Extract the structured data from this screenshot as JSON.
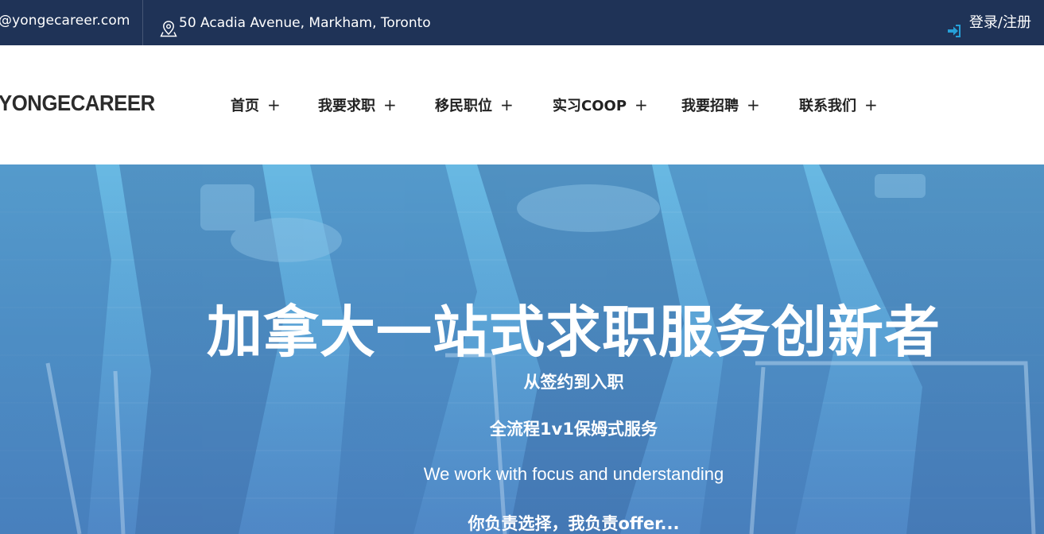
{
  "topbar": {
    "email": "@yongecareer.com",
    "address": "50 Acadia Avenue, Markham, Toronto",
    "login": "登录/注册",
    "colors": {
      "background": "#1f3357",
      "login_icon": "#26a0d8"
    },
    "icons": {
      "address": "map-pin-icon",
      "login": "sign-in-icon"
    }
  },
  "header": {
    "logo": "YONGECAREER",
    "nav": [
      {
        "label": "首页",
        "expand": "+"
      },
      {
        "label": "我要求职",
        "expand": "+"
      },
      {
        "label": "移民职位",
        "expand": "+"
      },
      {
        "label": "实习COOP",
        "expand": "+"
      },
      {
        "label": "我要招聘",
        "expand": "+"
      },
      {
        "label": "联系我们",
        "expand": "+"
      }
    ]
  },
  "hero": {
    "title": "加拿大一站式求职服务创新者",
    "line1": "从签约到入职",
    "line2": "全流程1v1保姆式服务",
    "line3": "We work with focus and understanding",
    "line4": "你负责选择，我负责offer..."
  }
}
